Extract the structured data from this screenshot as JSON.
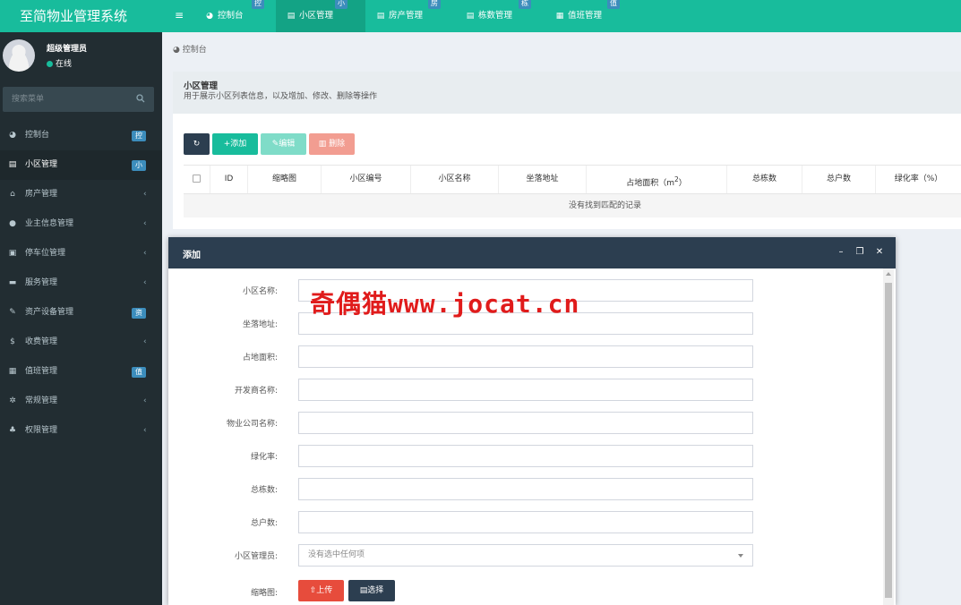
{
  "app": {
    "title": "至简物业管理系统"
  },
  "topnav": {
    "tabs": [
      {
        "label": "控制台",
        "icon": "dashboard-icon",
        "badge": "控"
      },
      {
        "label": "小区管理",
        "icon": "list-icon",
        "badge": "小"
      },
      {
        "label": "房产管理",
        "icon": "list-icon",
        "badge": "房"
      },
      {
        "label": "栋数管理",
        "icon": "list-icon",
        "badge": "栋"
      },
      {
        "label": "值班管理",
        "icon": "calendar-icon",
        "badge": "值"
      }
    ]
  },
  "sidebar": {
    "user": {
      "name": "超级管理员",
      "status": "在线"
    },
    "search_placeholder": "搜索菜单",
    "items": [
      {
        "label": "控制台",
        "icon": "dashboard-icon",
        "badge": "控"
      },
      {
        "label": "小区管理",
        "icon": "list-icon",
        "badge": "小"
      },
      {
        "label": "房产管理",
        "icon": "home-icon"
      },
      {
        "label": "业主信息管理",
        "icon": "user-icon"
      },
      {
        "label": "停车位管理",
        "icon": "film-icon"
      },
      {
        "label": "服务管理",
        "icon": "list-alt-icon"
      },
      {
        "label": "资产设备管理",
        "icon": "wrench-icon",
        "badge": "资"
      },
      {
        "label": "收费管理",
        "icon": "dollar-icon"
      },
      {
        "label": "值班管理",
        "icon": "calendar-icon",
        "badge": "值"
      },
      {
        "label": "常规管理",
        "icon": "cogs-icon"
      },
      {
        "label": "权限管理",
        "icon": "group-icon"
      }
    ]
  },
  "breadcrumb": "控制台",
  "panel": {
    "title": "小区管理",
    "description": "用于展示小区列表信息，以及增加、修改、删除等操作"
  },
  "toolbar": {
    "refresh_icon": "refresh-icon",
    "add_label": "添加",
    "edit_label": "编辑",
    "delete_label": "删除"
  },
  "table": {
    "columns": [
      "ID",
      "缩略图",
      "小区编号",
      "小区名称",
      "坐落地址",
      "占地面积（m",
      "2",
      "）",
      "总栋数",
      "总户数",
      "绿化率（%）"
    ],
    "empty_text": "没有找到匹配的记录"
  },
  "dialog": {
    "title": "添加",
    "fields": [
      {
        "label": "小区名称:",
        "value": ""
      },
      {
        "label": "坐落地址:",
        "value": ""
      },
      {
        "label": "占地面积:",
        "value": ""
      },
      {
        "label": "开发商名称:",
        "value": ""
      },
      {
        "label": "物业公司名称:",
        "value": ""
      },
      {
        "label": "绿化率:",
        "value": ""
      },
      {
        "label": "总栋数:",
        "value": ""
      },
      {
        "label": "总户数:",
        "value": ""
      }
    ],
    "manager_label": "小区管理员:",
    "manager_placeholder": "没有选中任何项",
    "thumb_label": "缩略图:",
    "upload_label": "上传",
    "choose_label": "选择"
  },
  "watermark": {
    "cjk": "奇偶猫",
    "url": "www.jocat.cn"
  },
  "colors": {
    "header": "#18bc9c",
    "sidebar": "#222d32",
    "dialog_head": "#2c3e50",
    "danger": "#e74c3c",
    "badge": "#3c8dbc"
  }
}
